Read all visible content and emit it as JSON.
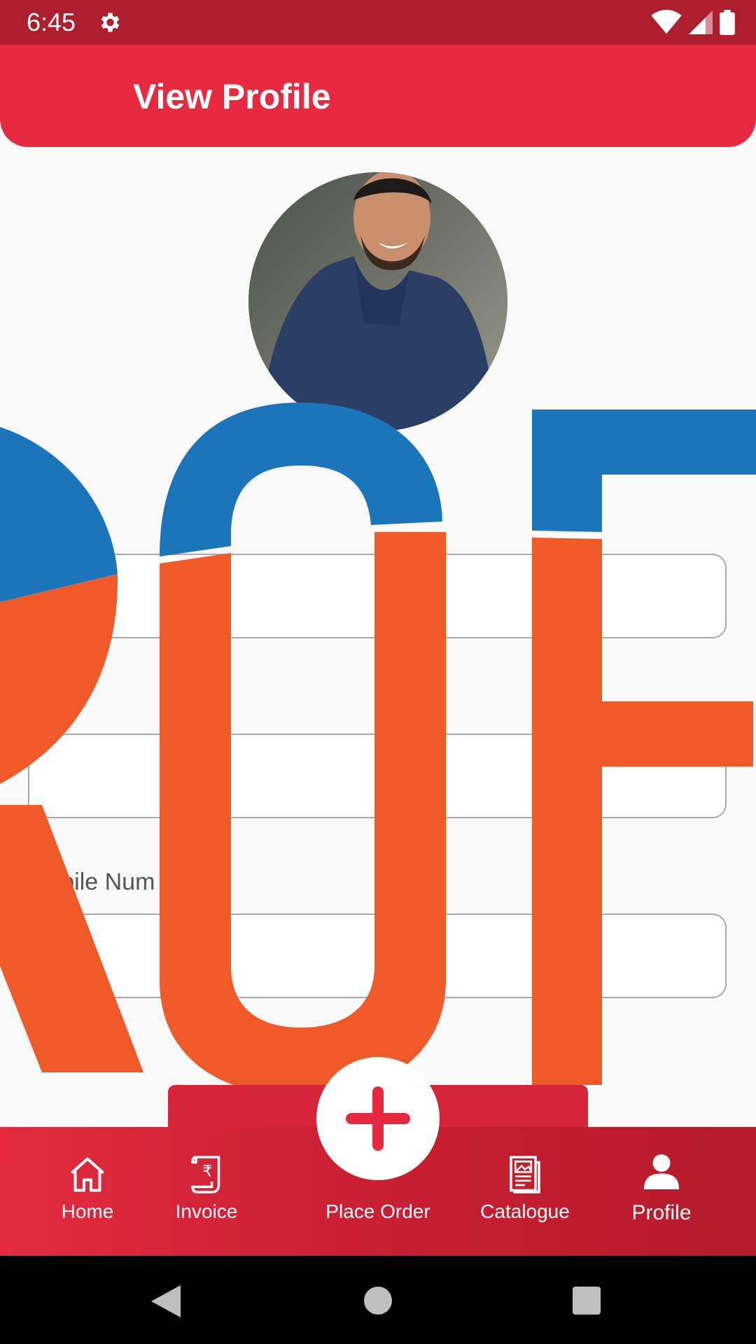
{
  "status_bar": {
    "time": "6:45"
  },
  "header": {
    "title": "View Profile"
  },
  "watermark_text": "ROF",
  "form": {
    "fields": [
      {
        "label": "",
        "value": ""
      },
      {
        "label": "",
        "value": ""
      },
      {
        "label": "Mobile Num",
        "value": ""
      }
    ]
  },
  "bottom_nav": {
    "items": [
      {
        "label": "Home",
        "icon": "home-icon"
      },
      {
        "label": "Invoice",
        "icon": "invoice-icon"
      },
      {
        "label": "Place Order",
        "icon": "plus-icon"
      },
      {
        "label": "Catalogue",
        "icon": "catalogue-icon"
      },
      {
        "label": "Profile",
        "icon": "profile-icon",
        "active": true
      }
    ]
  },
  "colors": {
    "status_bar": "#ad1f2f",
    "app_bar": "#e72a40",
    "watermark_blue": "#1b75bb",
    "watermark_orange": "#f05a28"
  }
}
